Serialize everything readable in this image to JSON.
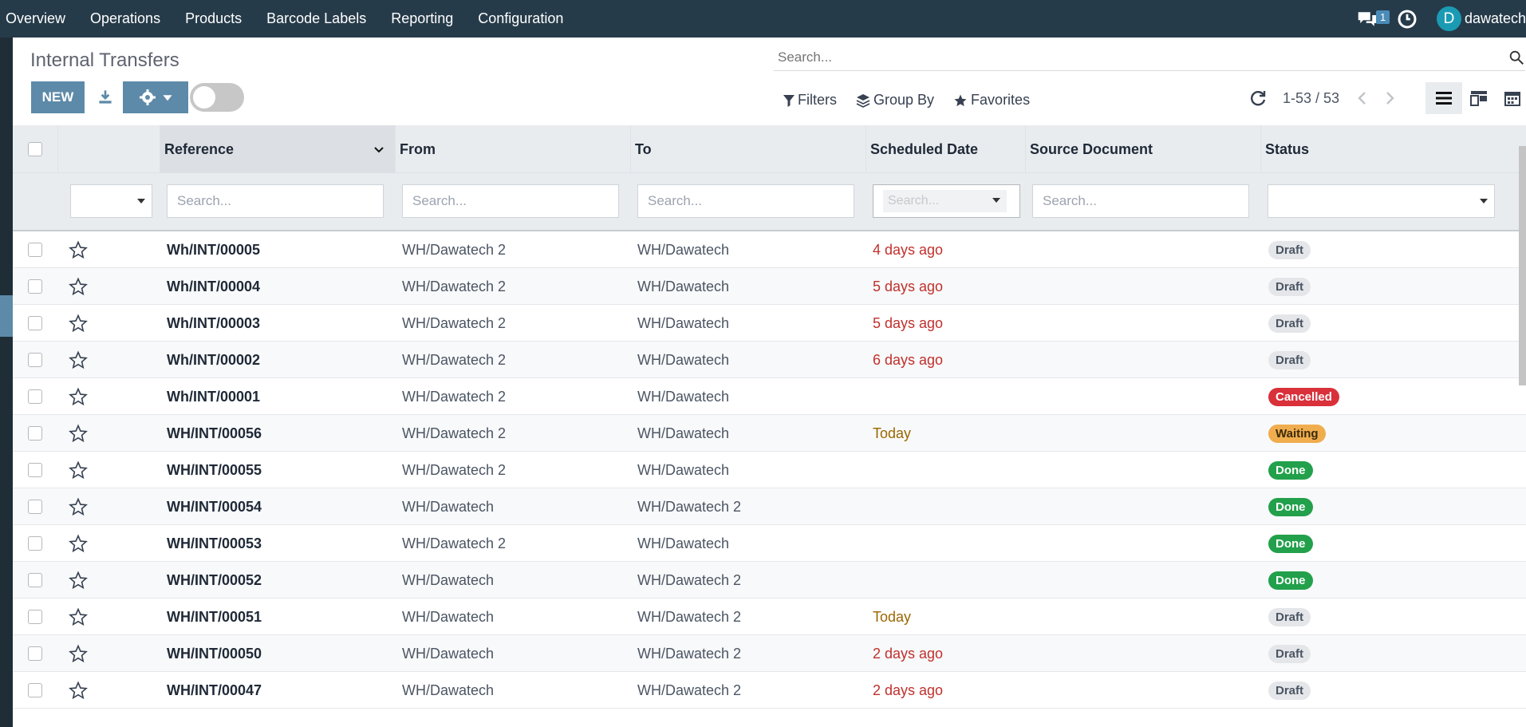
{
  "nav": {
    "menu": [
      "Overview",
      "Operations",
      "Products",
      "Barcode Labels",
      "Reporting",
      "Configuration"
    ],
    "chat_count": "1",
    "avatar_letter": "D",
    "username": "dawatech"
  },
  "page": {
    "title": "Internal Transfers",
    "new_label": "NEW",
    "search_placeholder": "Search...",
    "filters_label": "Filters",
    "groupby_label": "Group By",
    "favorites_label": "Favorites",
    "pager": "1-53 / 53"
  },
  "table": {
    "headers": {
      "reference": "Reference",
      "from": "From",
      "to": "To",
      "scheduled": "Scheduled Date",
      "source": "Source Document",
      "status": "Status"
    },
    "filter_placeholder": "Search...",
    "rows": [
      {
        "ref": "Wh/INT/00005",
        "from": "WH/Dawatech 2",
        "to": "WH/Dawatech",
        "date": "4 days ago",
        "date_type": "late",
        "status": "Draft",
        "status_type": "draft"
      },
      {
        "ref": "Wh/INT/00004",
        "from": "WH/Dawatech 2",
        "to": "WH/Dawatech",
        "date": "5 days ago",
        "date_type": "late",
        "status": "Draft",
        "status_type": "draft"
      },
      {
        "ref": "Wh/INT/00003",
        "from": "WH/Dawatech 2",
        "to": "WH/Dawatech",
        "date": "5 days ago",
        "date_type": "late",
        "status": "Draft",
        "status_type": "draft"
      },
      {
        "ref": "Wh/INT/00002",
        "from": "WH/Dawatech 2",
        "to": "WH/Dawatech",
        "date": "6 days ago",
        "date_type": "late",
        "status": "Draft",
        "status_type": "draft"
      },
      {
        "ref": "Wh/INT/00001",
        "from": "WH/Dawatech 2",
        "to": "WH/Dawatech",
        "date": "",
        "date_type": "",
        "status": "Cancelled",
        "status_type": "cancelled"
      },
      {
        "ref": "WH/INT/00056",
        "from": "WH/Dawatech 2",
        "to": "WH/Dawatech",
        "date": "Today",
        "date_type": "today",
        "status": "Waiting",
        "status_type": "waiting"
      },
      {
        "ref": "WH/INT/00055",
        "from": "WH/Dawatech 2",
        "to": "WH/Dawatech",
        "date": "",
        "date_type": "",
        "status": "Done",
        "status_type": "done"
      },
      {
        "ref": "WH/INT/00054",
        "from": "WH/Dawatech",
        "to": "WH/Dawatech 2",
        "date": "",
        "date_type": "",
        "status": "Done",
        "status_type": "done"
      },
      {
        "ref": "WH/INT/00053",
        "from": "WH/Dawatech 2",
        "to": "WH/Dawatech",
        "date": "",
        "date_type": "",
        "status": "Done",
        "status_type": "done"
      },
      {
        "ref": "WH/INT/00052",
        "from": "WH/Dawatech",
        "to": "WH/Dawatech 2",
        "date": "",
        "date_type": "",
        "status": "Done",
        "status_type": "done"
      },
      {
        "ref": "WH/INT/00051",
        "from": "WH/Dawatech",
        "to": "WH/Dawatech 2",
        "date": "Today",
        "date_type": "today",
        "status": "Draft",
        "status_type": "draft"
      },
      {
        "ref": "WH/INT/00050",
        "from": "WH/Dawatech",
        "to": "WH/Dawatech 2",
        "date": "2 days ago",
        "date_type": "late",
        "status": "Draft",
        "status_type": "draft"
      },
      {
        "ref": "WH/INT/00047",
        "from": "WH/Dawatech",
        "to": "WH/Dawatech 2",
        "date": "2 days ago",
        "date_type": "late",
        "status": "Draft",
        "status_type": "draft"
      }
    ]
  },
  "colors": {
    "navbar": "#263b4a",
    "primary": "#5d8aa8",
    "late": "#c0302c",
    "today": "#9a6700",
    "done": "#22a04b",
    "cancelled": "#d9303a",
    "waiting": "#f0ad4e"
  }
}
